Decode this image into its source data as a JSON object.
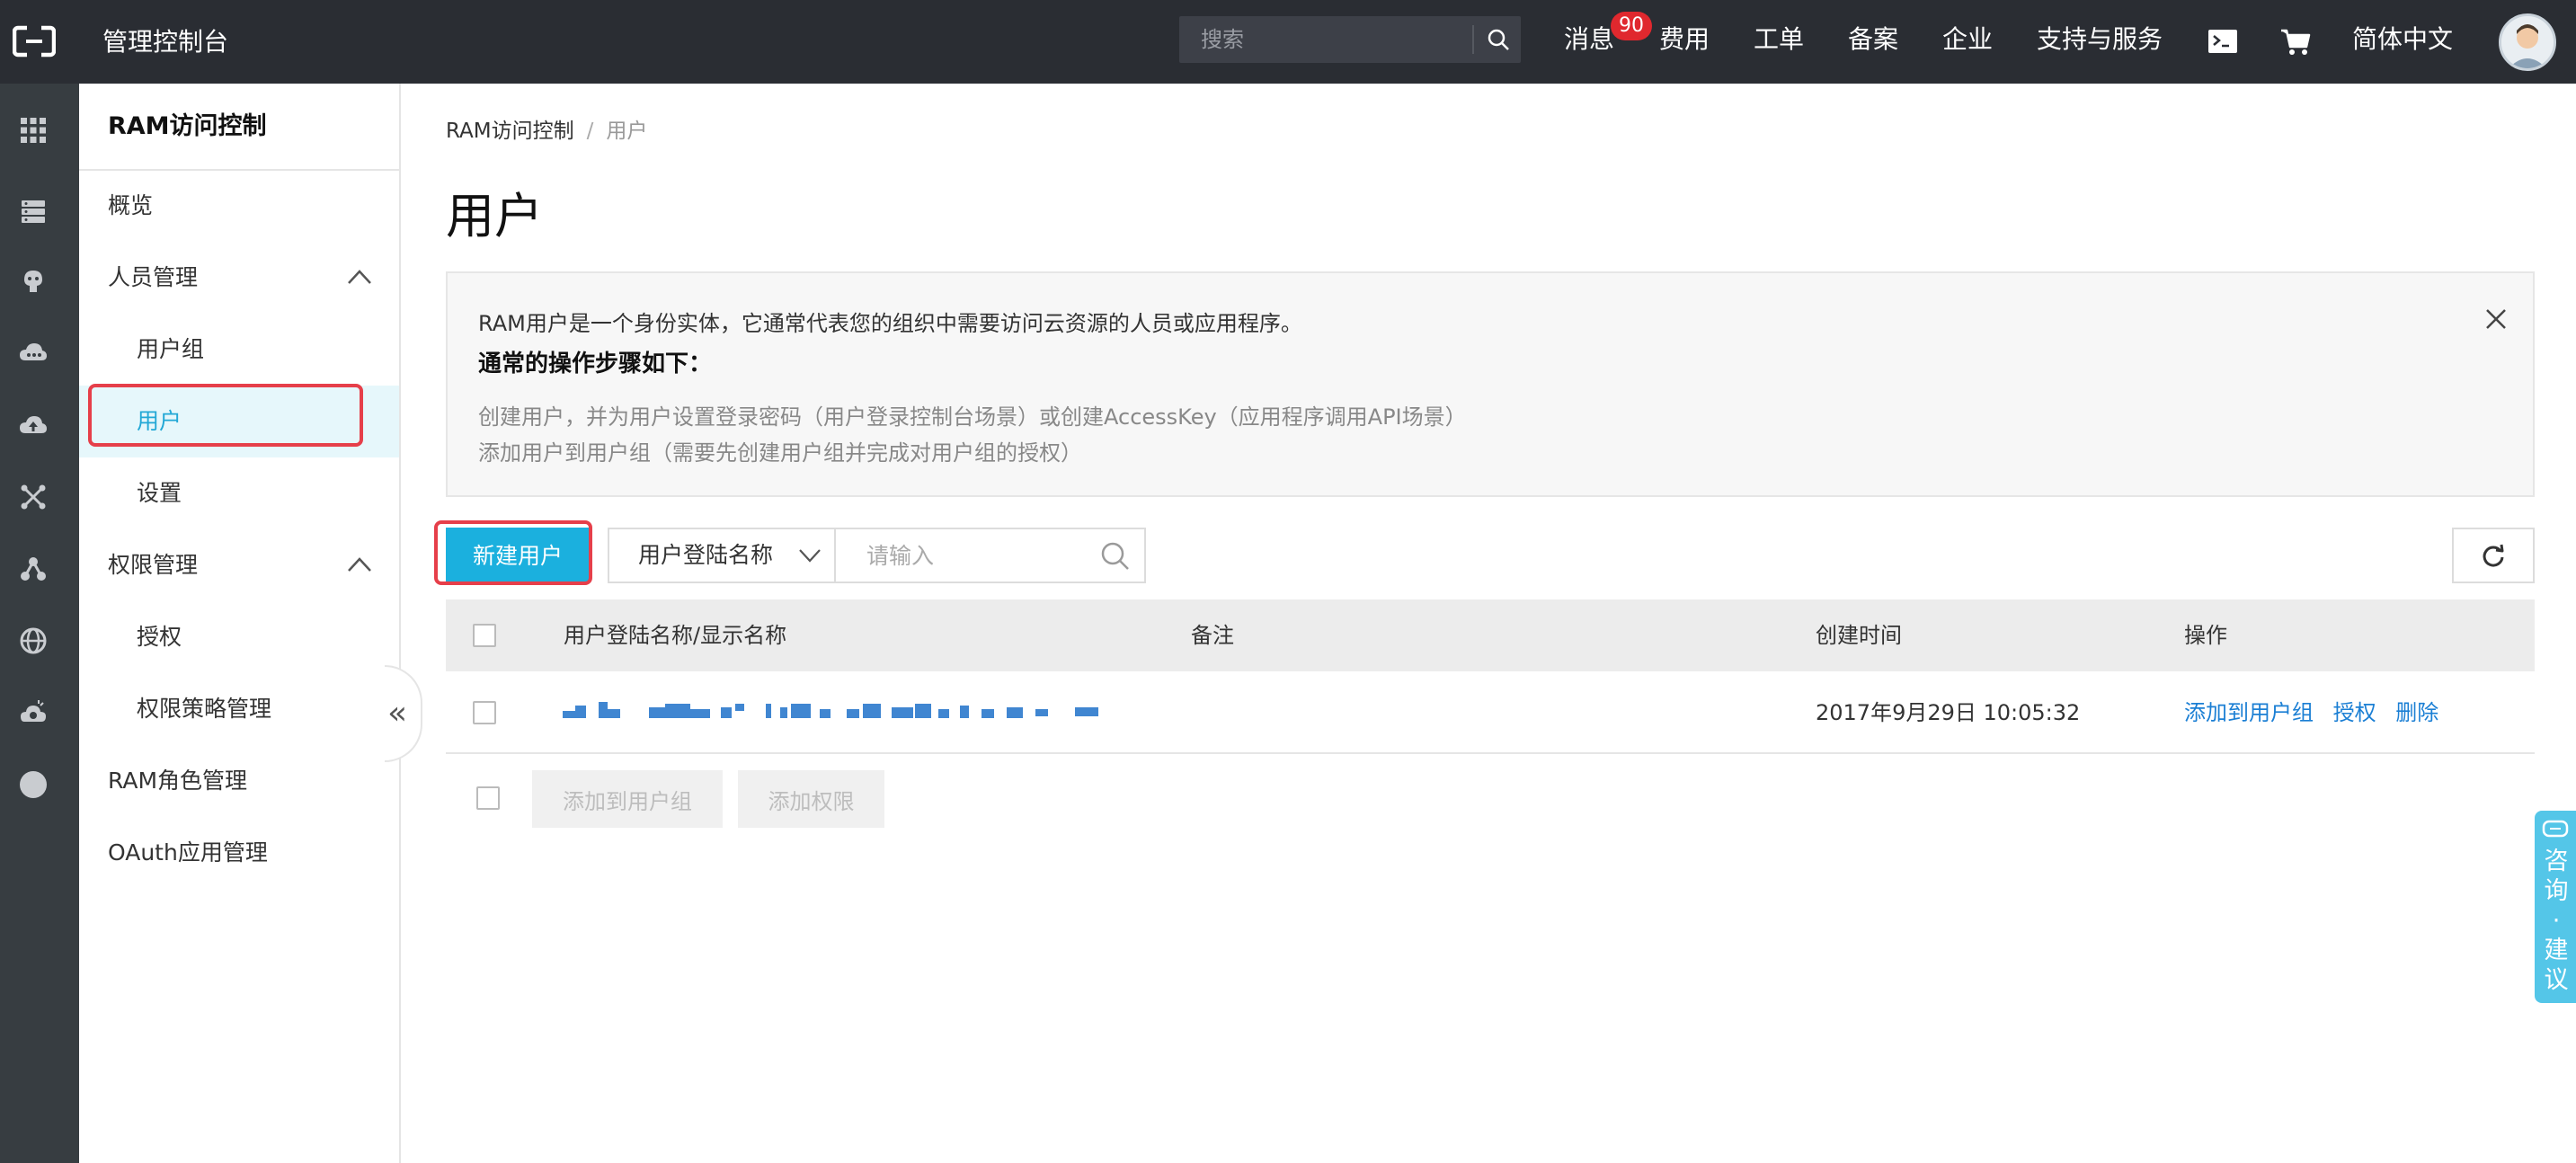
{
  "topbar": {
    "console_title": "管理控制台",
    "search_placeholder": "搜索",
    "nav": {
      "messages": "消息",
      "message_count": "90",
      "billing": "费用",
      "tickets": "工单",
      "icp": "备案",
      "enterprise": "企业",
      "support": "支持与服务",
      "language": "简体中文"
    },
    "icons": [
      "terminal-icon",
      "cart-icon",
      "avatar"
    ]
  },
  "rail": {
    "icons": [
      "apps-grid-icon",
      "server-icon",
      "brain-icon",
      "cloud-network-icon",
      "cloud-upload-icon",
      "cross-arrows-icon",
      "nodes-icon",
      "globe-icon",
      "cloud-gear-icon",
      "circle-icon"
    ]
  },
  "sidebar": {
    "title": "RAM访问控制",
    "items": [
      {
        "label": "概览"
      },
      {
        "label": "人员管理",
        "expanded": true
      },
      {
        "label": "用户组"
      },
      {
        "label": "用户",
        "active": true
      },
      {
        "label": "设置"
      },
      {
        "label": "权限管理",
        "expanded": true
      },
      {
        "label": "授权"
      },
      {
        "label": "权限策略管理"
      },
      {
        "label": "RAM角色管理"
      },
      {
        "label": "OAuth应用管理"
      }
    ],
    "collapse_glyph": "«"
  },
  "breadcrumb": {
    "root": "RAM访问控制",
    "separator": "/",
    "current": "用户"
  },
  "page_title": "用户",
  "notice": {
    "line1": "RAM用户是一个身份实体，它通常代表您的组织中需要访问云资源的人员或应用程序。",
    "line2": "通常的操作步骤如下：",
    "line3": "创建用户，并为用户设置登录密码（用户登录控制台场景）或创建AccessKey（应用程序调用API场景）",
    "line4": "添加用户到用户组（需要先创建用户组并完成对用户组的授权）"
  },
  "toolbar": {
    "new_user": "新建用户",
    "filter_field": "用户登陆名称",
    "filter_placeholder": "请输入"
  },
  "table": {
    "columns": {
      "name": "用户登陆名称/显示名称",
      "note": "备注",
      "created": "创建时间",
      "actions": "操作"
    },
    "rows": [
      {
        "name_redacted": true,
        "note": "",
        "created": "2017年9月29日 10:05:32",
        "action_add_group": "添加到用户组",
        "action_grant": "授权",
        "action_delete": "删除"
      }
    ]
  },
  "bulk": {
    "add_to_group": "添加到用户组",
    "add_permission": "添加权限"
  },
  "feedback": {
    "label": "咨询·建议"
  },
  "colors": {
    "topbar_bg": "#2a2d33",
    "rail_bg": "#373d41",
    "accent": "#1bb0de",
    "active_text": "#22a8d6",
    "link": "#1b7fd4",
    "highlight_outline": "#e63f4a",
    "badge": "#e0282e"
  }
}
